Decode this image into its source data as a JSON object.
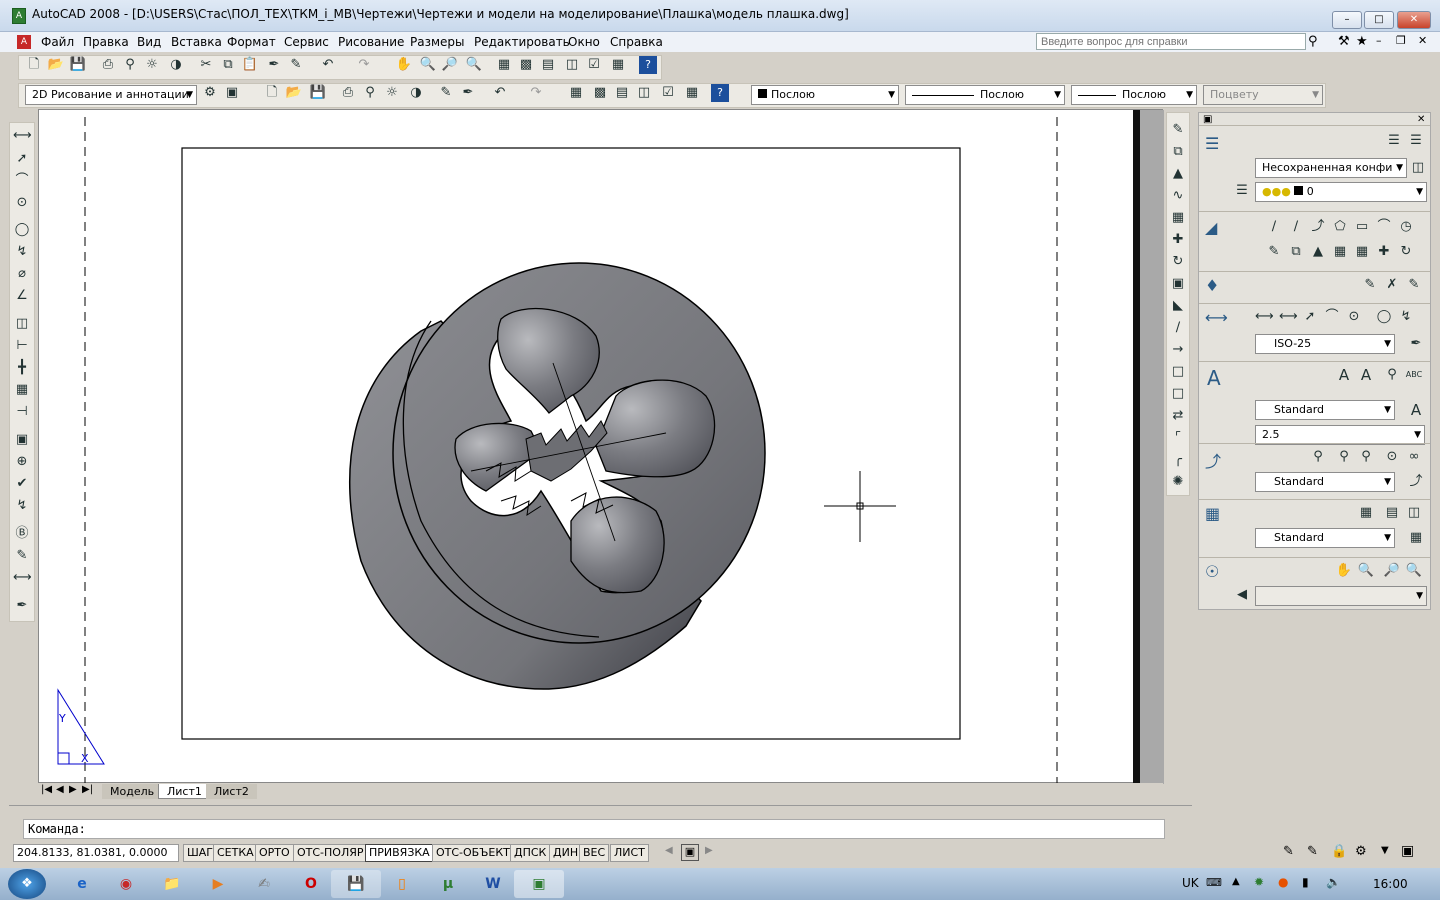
{
  "window": {
    "title": "AutoCAD 2008 - [D:\\USERS\\Стас\\ПОЛ_ТЕХ\\ТКМ_i_МВ\\Чертежи\\Чертежи и модели на моделирование\\Плашка\\модель плашка.dwg]",
    "app_icon_text": "A"
  },
  "menu": {
    "items": [
      "Файл",
      "Правка",
      "Вид",
      "Вставка",
      "Формат",
      "Сервис",
      "Рисование",
      "Размеры",
      "Редактировать",
      "Окно",
      "Справка"
    ],
    "help_placeholder": "Введите вопрос для справки"
  },
  "toolbar2": {
    "workspace": "2D Рисование и аннотации",
    "color": "Послою",
    "linetype": "Послою",
    "lineweight": "Послою",
    "plotstyle": "Поцвету"
  },
  "dashboard": {
    "layer_state": "Несохраненная конфи",
    "layer": "0",
    "dim_style": "ISO-25",
    "text_style": "Standard",
    "text_height": "2.5",
    "mleader_style": "Standard",
    "table_style": "Standard",
    "table_style2": "Standard"
  },
  "layout_tabs": [
    "Модель",
    "Лист1",
    "Лист2"
  ],
  "ucs": {
    "y": "Y",
    "x": "X"
  },
  "command": {
    "prompt": "Команда:"
  },
  "status": {
    "coords": "204.8133, 81.0381, 0.0000",
    "toggles": [
      "ШАГ",
      "СЕТКА",
      "ОРТО",
      "ОТС-ПОЛЯР",
      "ПРИВЯЗКА",
      "ОТС-ОБЪЕКТ",
      "ДПСК",
      "ДИН",
      "ВЕС",
      "ЛИСТ"
    ],
    "active": [
      "ПРИВЯЗКА"
    ]
  },
  "taskbar": {
    "lang": "UK",
    "time": "16:00"
  }
}
